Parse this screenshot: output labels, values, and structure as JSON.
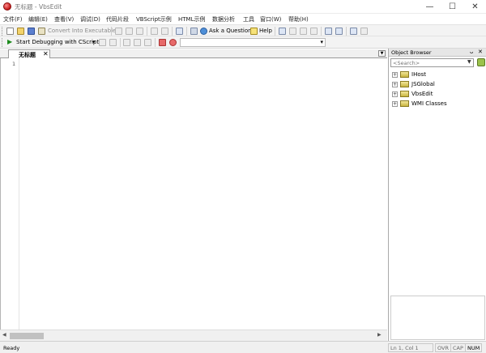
{
  "window": {
    "title": "无标题 - VbsEdit",
    "buttons": {
      "minimize": "—",
      "maximize": "☐",
      "close": "✕"
    }
  },
  "menu": {
    "items": [
      "文件(F)",
      "编辑(E)",
      "查看(V)",
      "调试(D)",
      "代码片段",
      "VBScript示例",
      "HTML示例",
      "数据分析",
      "工具",
      "窗口(W)",
      "帮助(H)"
    ]
  },
  "toolbar": {
    "convert_label": "Convert Into Executable",
    "ask_label": "Ask a Question",
    "help_label": "Help",
    "start_debug_label": "Start Debugging with CScript",
    "dropdown_arrow": "▾"
  },
  "editor": {
    "tab_label": "无标题",
    "tab_close": "✕",
    "line_numbers": [
      "1"
    ]
  },
  "object_browser": {
    "title": "Object Browser",
    "pin": "ᴗ",
    "close": "✕",
    "search_placeholder": "<Search>",
    "items": [
      {
        "label": "IHost",
        "expander": "+"
      },
      {
        "label": "JSGlobal",
        "expander": "+"
      },
      {
        "label": "VbsEdit",
        "expander": "+"
      },
      {
        "label": "WMI Classes",
        "expander": "+"
      }
    ]
  },
  "statusbar": {
    "text": "Ready",
    "position": "Ln 1, Col 1",
    "ovr": "OVR",
    "cap": "CAP",
    "num": "NUM"
  },
  "colors": {
    "accent": "#c21818",
    "toolbar_bg": "#f3f3f3",
    "statusbar_bg": "#f0f0f0"
  }
}
